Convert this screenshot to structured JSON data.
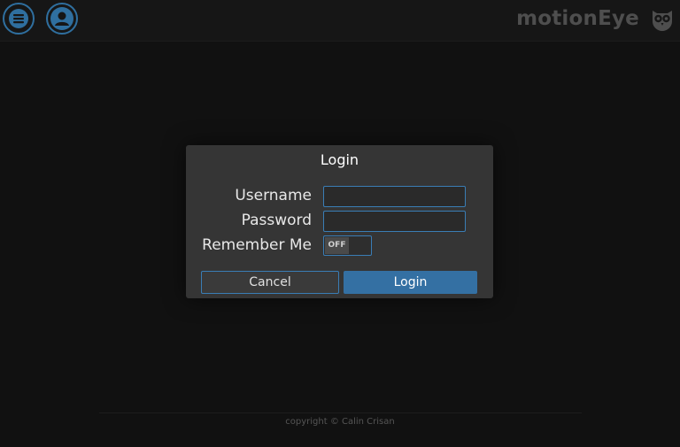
{
  "header": {
    "brand": "motionEye",
    "menu_icon": "menu-icon",
    "user_icon": "user-icon",
    "logo_icon": "owl-logo-icon",
    "accent_color": "#2f6f9f"
  },
  "login_dialog": {
    "title": "Login",
    "username_label": "Username",
    "username_value": "",
    "password_label": "Password",
    "password_value": "",
    "remember_label": "Remember Me",
    "remember_state": "OFF",
    "cancel_label": "Cancel",
    "login_label": "Login",
    "primary_color": "#3470a3"
  },
  "footer": {
    "copyright": "copyright © Calin Crisan"
  }
}
